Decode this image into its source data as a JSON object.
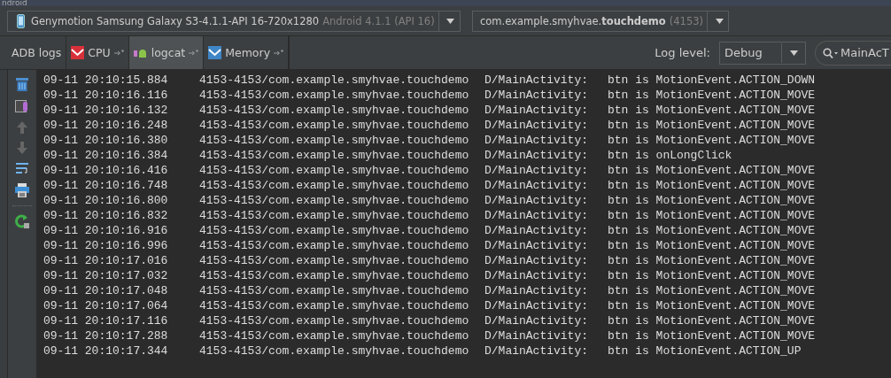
{
  "window": {
    "title": "ndroid"
  },
  "device": {
    "name": "Genymotion Samsung Galaxy S3-4.1.1-API 16-720x1280",
    "version": "Android 4.1.1 (API 16)"
  },
  "process": {
    "name": "com.example.smyhvae.**touchdemo**",
    "pid": "(4153)"
  },
  "tabs": [
    {
      "label": "ADB logs",
      "kind": "plain",
      "selected": false
    },
    {
      "label": "CPU",
      "kind": "cpu",
      "selected": false
    },
    {
      "label": "logcat",
      "kind": "logcat",
      "selected": true
    },
    {
      "label": "Memory",
      "kind": "memory",
      "selected": false
    }
  ],
  "log_level": {
    "label": "Log level:",
    "value": "Debug"
  },
  "search": {
    "value": "MainAcT"
  },
  "toolbar": {
    "scroll_up_disabled": true,
    "scroll_down_disabled": true
  },
  "log": [
    {
      "time": "09-11 20:10:15.884",
      "source": "4153-4153/com.example.smyhvae.touchdemo",
      "tag": "D/MainActivity:",
      "message": "btn is MotionEvent.ACTION_DOWN"
    },
    {
      "time": "09-11 20:10:16.116",
      "source": "4153-4153/com.example.smyhvae.touchdemo",
      "tag": "D/MainActivity:",
      "message": "btn is MotionEvent.ACTION_MOVE"
    },
    {
      "time": "09-11 20:10:16.132",
      "source": "4153-4153/com.example.smyhvae.touchdemo",
      "tag": "D/MainActivity:",
      "message": "btn is MotionEvent.ACTION_MOVE"
    },
    {
      "time": "09-11 20:10:16.248",
      "source": "4153-4153/com.example.smyhvae.touchdemo",
      "tag": "D/MainActivity:",
      "message": "btn is MotionEvent.ACTION_MOVE"
    },
    {
      "time": "09-11 20:10:16.380",
      "source": "4153-4153/com.example.smyhvae.touchdemo",
      "tag": "D/MainActivity:",
      "message": "btn is MotionEvent.ACTION_MOVE"
    },
    {
      "time": "09-11 20:10:16.384",
      "source": "4153-4153/com.example.smyhvae.touchdemo",
      "tag": "D/MainActivity:",
      "message": "btn is onLongClick"
    },
    {
      "time": "09-11 20:10:16.416",
      "source": "4153-4153/com.example.smyhvae.touchdemo",
      "tag": "D/MainActivity:",
      "message": "btn is MotionEvent.ACTION_MOVE"
    },
    {
      "time": "09-11 20:10:16.748",
      "source": "4153-4153/com.example.smyhvae.touchdemo",
      "tag": "D/MainActivity:",
      "message": "btn is MotionEvent.ACTION_MOVE"
    },
    {
      "time": "09-11 20:10:16.800",
      "source": "4153-4153/com.example.smyhvae.touchdemo",
      "tag": "D/MainActivity:",
      "message": "btn is MotionEvent.ACTION_MOVE"
    },
    {
      "time": "09-11 20:10:16.832",
      "source": "4153-4153/com.example.smyhvae.touchdemo",
      "tag": "D/MainActivity:",
      "message": "btn is MotionEvent.ACTION_MOVE"
    },
    {
      "time": "09-11 20:10:16.916",
      "source": "4153-4153/com.example.smyhvae.touchdemo",
      "tag": "D/MainActivity:",
      "message": "btn is MotionEvent.ACTION_MOVE"
    },
    {
      "time": "09-11 20:10:16.996",
      "source": "4153-4153/com.example.smyhvae.touchdemo",
      "tag": "D/MainActivity:",
      "message": "btn is MotionEvent.ACTION_MOVE"
    },
    {
      "time": "09-11 20:10:17.016",
      "source": "4153-4153/com.example.smyhvae.touchdemo",
      "tag": "D/MainActivity:",
      "message": "btn is MotionEvent.ACTION_MOVE"
    },
    {
      "time": "09-11 20:10:17.032",
      "source": "4153-4153/com.example.smyhvae.touchdemo",
      "tag": "D/MainActivity:",
      "message": "btn is MotionEvent.ACTION_MOVE"
    },
    {
      "time": "09-11 20:10:17.048",
      "source": "4153-4153/com.example.smyhvae.touchdemo",
      "tag": "D/MainActivity:",
      "message": "btn is MotionEvent.ACTION_MOVE"
    },
    {
      "time": "09-11 20:10:17.064",
      "source": "4153-4153/com.example.smyhvae.touchdemo",
      "tag": "D/MainActivity:",
      "message": "btn is MotionEvent.ACTION_MOVE"
    },
    {
      "time": "09-11 20:10:17.116",
      "source": "4153-4153/com.example.smyhvae.touchdemo",
      "tag": "D/MainActivity:",
      "message": "btn is MotionEvent.ACTION_MOVE"
    },
    {
      "time": "09-11 20:10:17.288",
      "source": "4153-4153/com.example.smyhvae.touchdemo",
      "tag": "D/MainActivity:",
      "message": "btn is MotionEvent.ACTION_MOVE"
    },
    {
      "time": "09-11 20:10:17.344",
      "source": "4153-4153/com.example.smyhvae.touchdemo",
      "tag": "D/MainActivity:",
      "message": "btn is MotionEvent.ACTION_UP"
    }
  ]
}
